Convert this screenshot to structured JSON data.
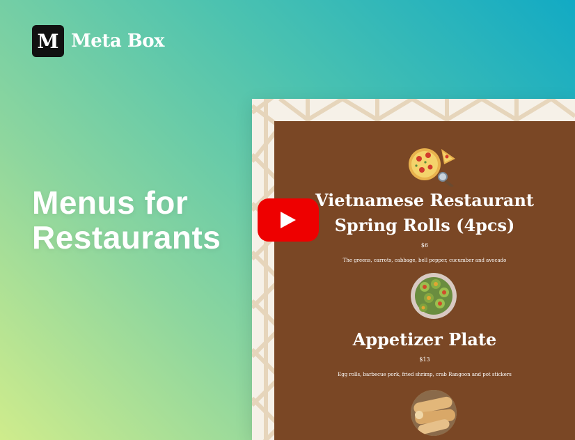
{
  "brand": {
    "logo_letter": "M",
    "name": "Meta Box"
  },
  "headline": {
    "line1": "Menus for",
    "line2": "Restaurants"
  },
  "menu": {
    "items": [
      {
        "title_line1": "Vietnamese Restaurant",
        "title_line2": "Spring Rolls (4pcs)",
        "price": "$6",
        "description": "The greens, carrots, cabbage, bell pepper, cucumber and avocado",
        "image": "pizza-icon"
      },
      {
        "title": "Appetizer Plate",
        "price": "$13",
        "description": "Egg rolls, barbecue pork, fried shrimp, crab Rangoon and pot stickers",
        "image": "appetizer-photo"
      },
      {
        "image": "egg-rolls-photo"
      }
    ]
  },
  "video": {
    "icon": "youtube-play-icon"
  },
  "colors": {
    "menu_background": "#7a4725",
    "play_button": "#ee0000",
    "brand_logo_bg": "#111111"
  }
}
